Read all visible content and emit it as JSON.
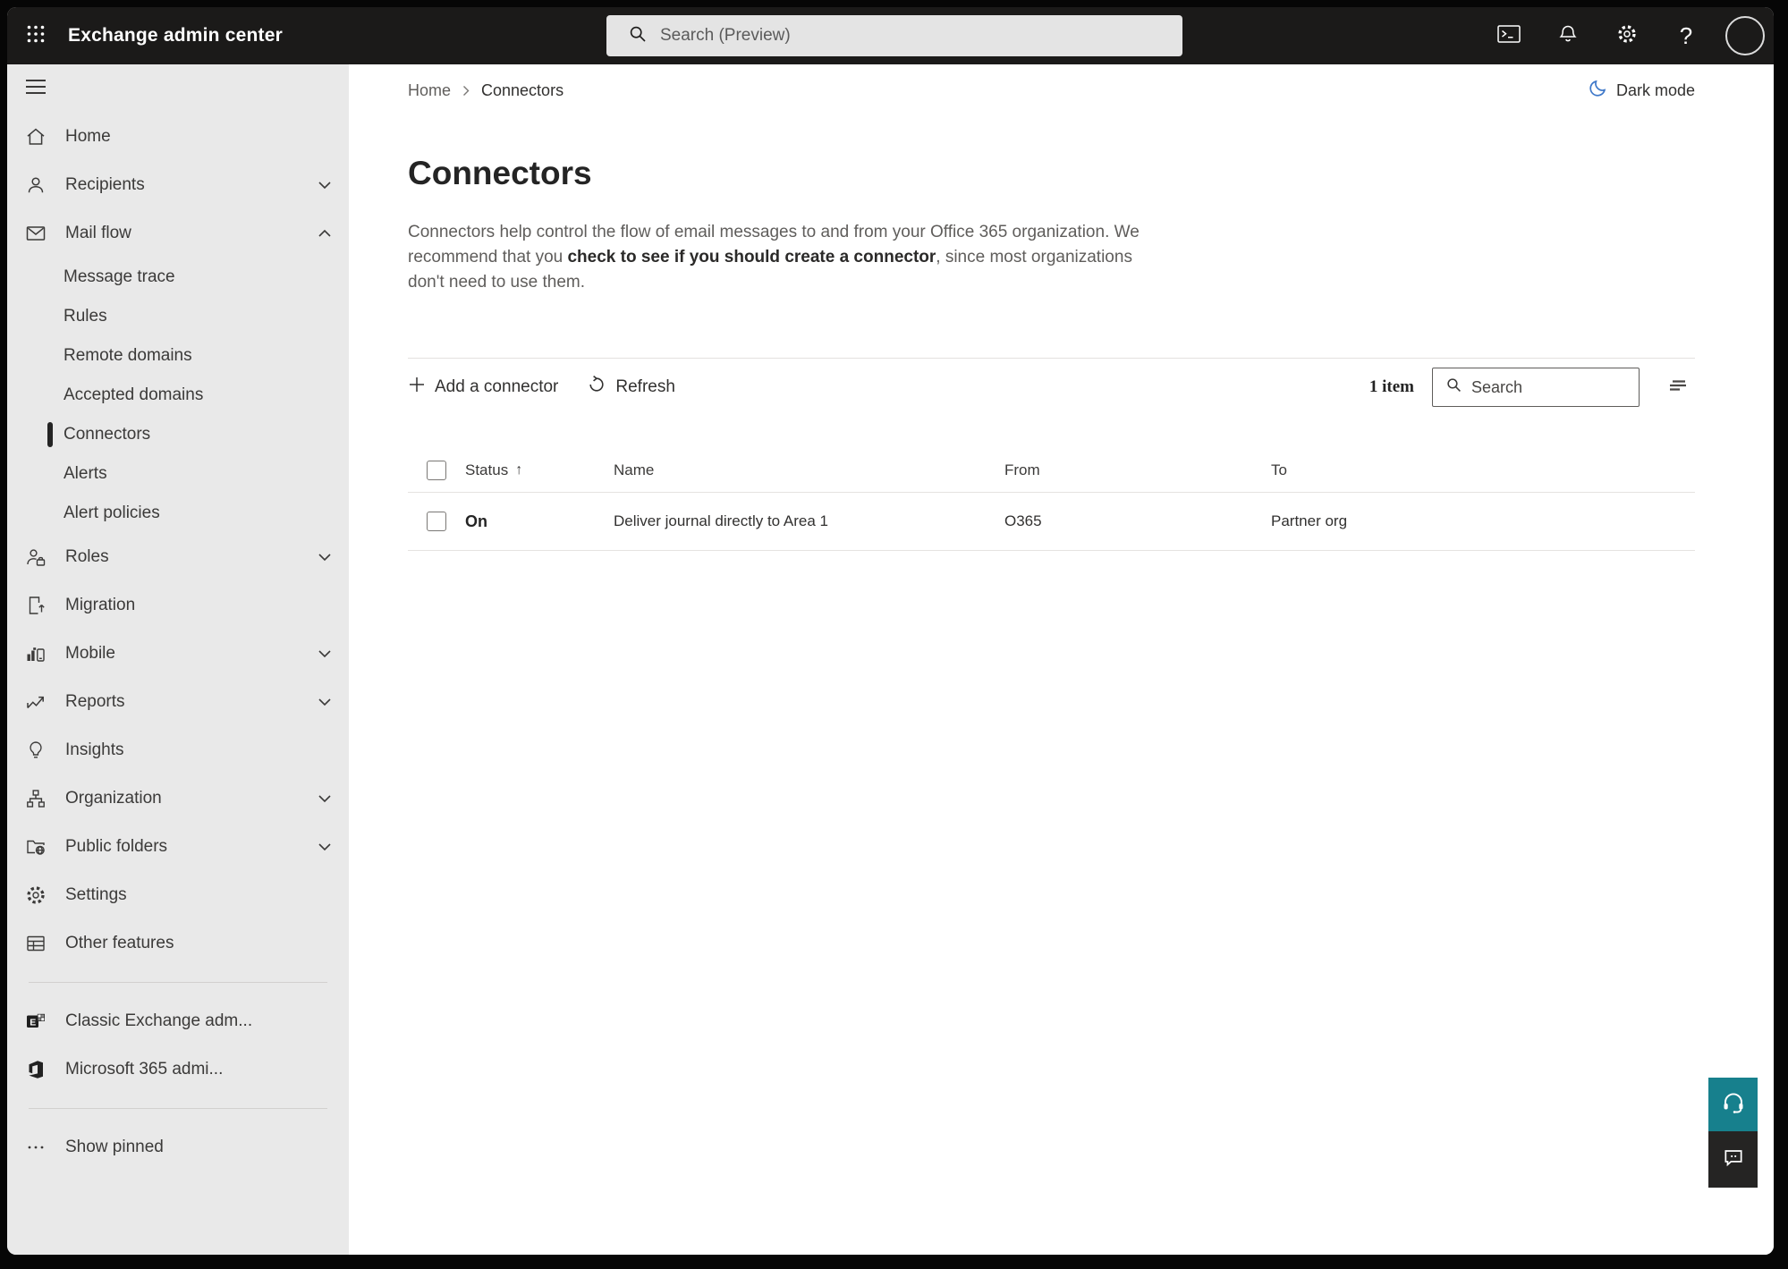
{
  "colors": {
    "topbar_bg": "#1b1a19",
    "sidebar_bg": "#e9e9e9",
    "selected_indicator": "#242424",
    "moon_blue": "#3e78c9",
    "help_teal": "#17808d",
    "feedback_dark": "#252423"
  },
  "topbar": {
    "app_title": "Exchange admin center",
    "search_placeholder": "Search (Preview)",
    "icon_names": [
      "app-launcher-icon",
      "search-icon",
      "terminal-icon",
      "notifications-bell-icon",
      "settings-gear-icon",
      "help-icon",
      "account-avatar"
    ]
  },
  "sidebar": {
    "icon_names": [
      "hamburger-icon",
      "home-icon",
      "person-icon",
      "mail-icon",
      "roles-icon",
      "migration-icon",
      "mobile-icon",
      "reports-icon",
      "insights-icon",
      "organization-icon",
      "public-folders-icon",
      "settings-gear-icon",
      "other-features-icon",
      "classic-exchange-icon",
      "microsoft-365-icon",
      "ellipsis-icon"
    ],
    "items": [
      {
        "label": "Home"
      },
      {
        "label": "Recipients",
        "expandable": true,
        "expanded": false
      },
      {
        "label": "Mail flow",
        "expandable": true,
        "expanded": true,
        "children": [
          "Message trace",
          "Rules",
          "Remote domains",
          "Accepted domains",
          "Connectors",
          "Alerts",
          "Alert policies"
        ],
        "selected_child": "Connectors"
      },
      {
        "label": "Roles",
        "expandable": true,
        "expanded": false
      },
      {
        "label": "Migration"
      },
      {
        "label": "Mobile",
        "expandable": true,
        "expanded": false
      },
      {
        "label": "Reports",
        "expandable": true,
        "expanded": false
      },
      {
        "label": "Insights"
      },
      {
        "label": "Organization",
        "expandable": true,
        "expanded": false
      },
      {
        "label": "Public folders",
        "expandable": true,
        "expanded": false
      },
      {
        "label": "Settings"
      },
      {
        "label": "Other features"
      }
    ],
    "footer_links": [
      {
        "label": "Classic Exchange adm..."
      },
      {
        "label": "Microsoft 365 admi..."
      }
    ],
    "show_pinned_label": "Show pinned"
  },
  "main": {
    "breadcrumb": {
      "items": [
        "Home",
        "Connectors"
      ]
    },
    "dark_mode_label": "Dark mode",
    "page_title": "Connectors",
    "description": {
      "before_link": "Connectors help control the flow of email messages to and from your Office 365 organization. We recommend that you ",
      "link_text": "check to see if you should create a connector",
      "after_link": ", since most organizations don't need to use them."
    },
    "toolbar": {
      "add_button_label": "Add a connector",
      "refresh_button_label": "Refresh",
      "item_count": "1 item",
      "search_placeholder": "Search",
      "sort_indicator": "↑"
    },
    "table": {
      "columns": [
        "Status",
        "Name",
        "From",
        "To"
      ],
      "sort_column": "Status",
      "sort_direction": "ascending",
      "rows": [
        {
          "status": "On",
          "name": "Deliver journal directly to Area 1",
          "from": "O365",
          "to": "Partner org"
        }
      ]
    }
  }
}
